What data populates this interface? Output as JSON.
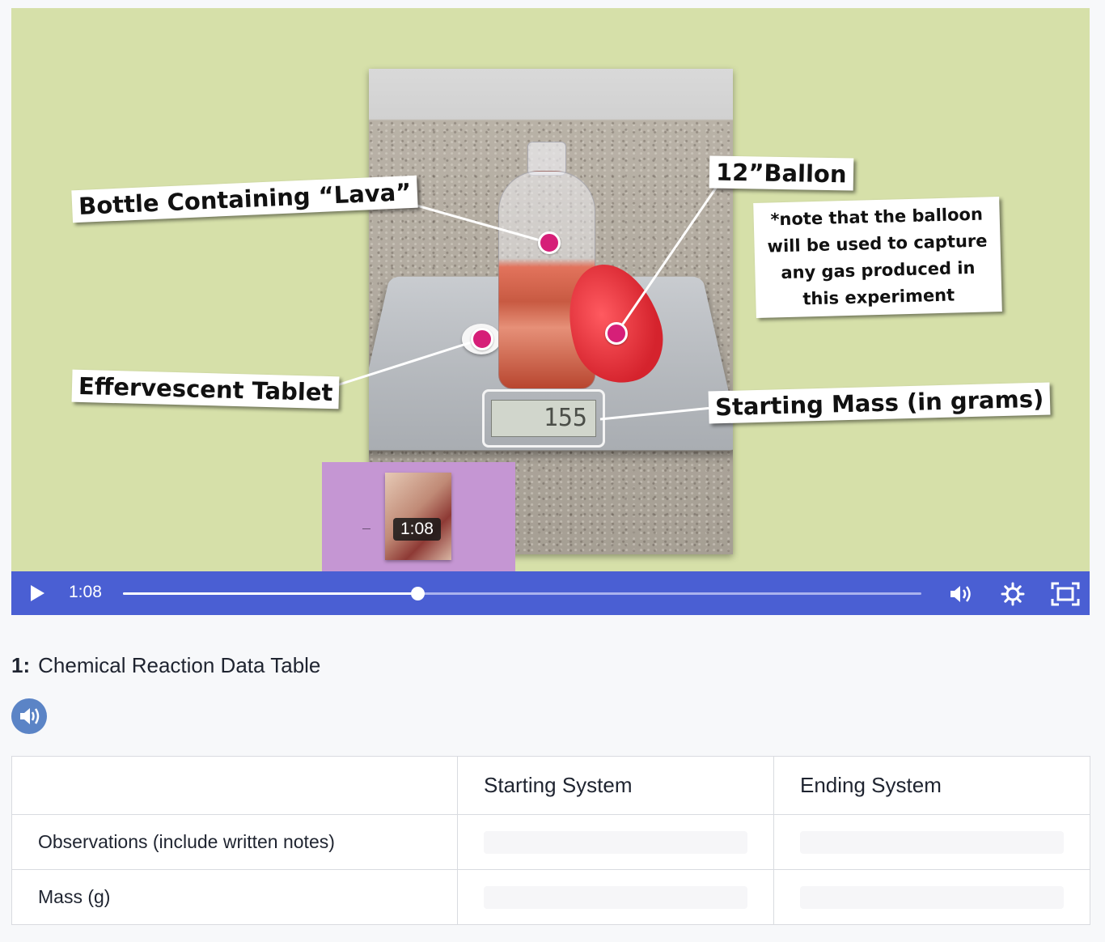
{
  "video": {
    "callouts": {
      "bottle": "Bottle Containing “Lava”",
      "tablet": "Effervescent Tablet",
      "balloon": "12”Ballon",
      "note": "*note that the balloon will be used to capture any gas produced in this experiment",
      "mass": "Starting Mass (in grams)"
    },
    "scale_reading": "155",
    "preview_time": "1:08",
    "current_time": "1:08",
    "progress": 0.369,
    "icons": [
      "play-icon",
      "volume-icon",
      "settings-gear-icon",
      "fullscreen-icon"
    ],
    "colors": {
      "controls": "#4a5fd3",
      "dot": "#d61f78",
      "background": "#d6e0a9"
    }
  },
  "question": {
    "number": "1:",
    "title": "Chemical Reaction Data Table",
    "audio_icon": "speaker-icon"
  },
  "table": {
    "headers": [
      "",
      "Starting System",
      "Ending System"
    ],
    "rows": [
      {
        "label": "Observations (include written notes)"
      },
      {
        "label": "Mass (g)"
      }
    ]
  }
}
